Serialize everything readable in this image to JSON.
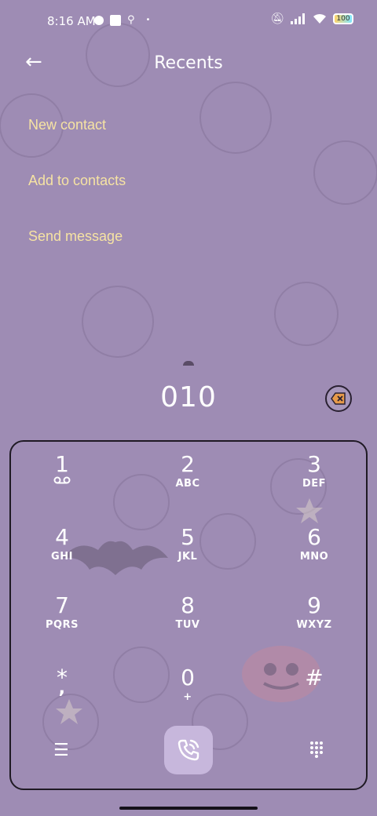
{
  "status_bar": {
    "time": "8:16 AM",
    "battery": "100"
  },
  "header": {
    "title": "Recents"
  },
  "menu": {
    "new_contact": "New contact",
    "add_to_contacts": "Add to contacts",
    "send_message": "Send message"
  },
  "dialer": {
    "number": "010",
    "keys": [
      {
        "digit": "1",
        "letters": ""
      },
      {
        "digit": "2",
        "letters": "ABC"
      },
      {
        "digit": "3",
        "letters": "DEF"
      },
      {
        "digit": "4",
        "letters": "GHI"
      },
      {
        "digit": "5",
        "letters": "JKL"
      },
      {
        "digit": "6",
        "letters": "MNO"
      },
      {
        "digit": "7",
        "letters": "PQRS"
      },
      {
        "digit": "8",
        "letters": "TUV"
      },
      {
        "digit": "9",
        "letters": "WXYZ"
      },
      {
        "digit": "*",
        "letters": ","
      },
      {
        "digit": "0",
        "letters": "+"
      },
      {
        "digit": "#",
        "letters": ""
      }
    ]
  },
  "colors": {
    "background": "#9e8cb4",
    "menu_text": "#f6e3a3",
    "call_button": "#c7b7dc"
  }
}
